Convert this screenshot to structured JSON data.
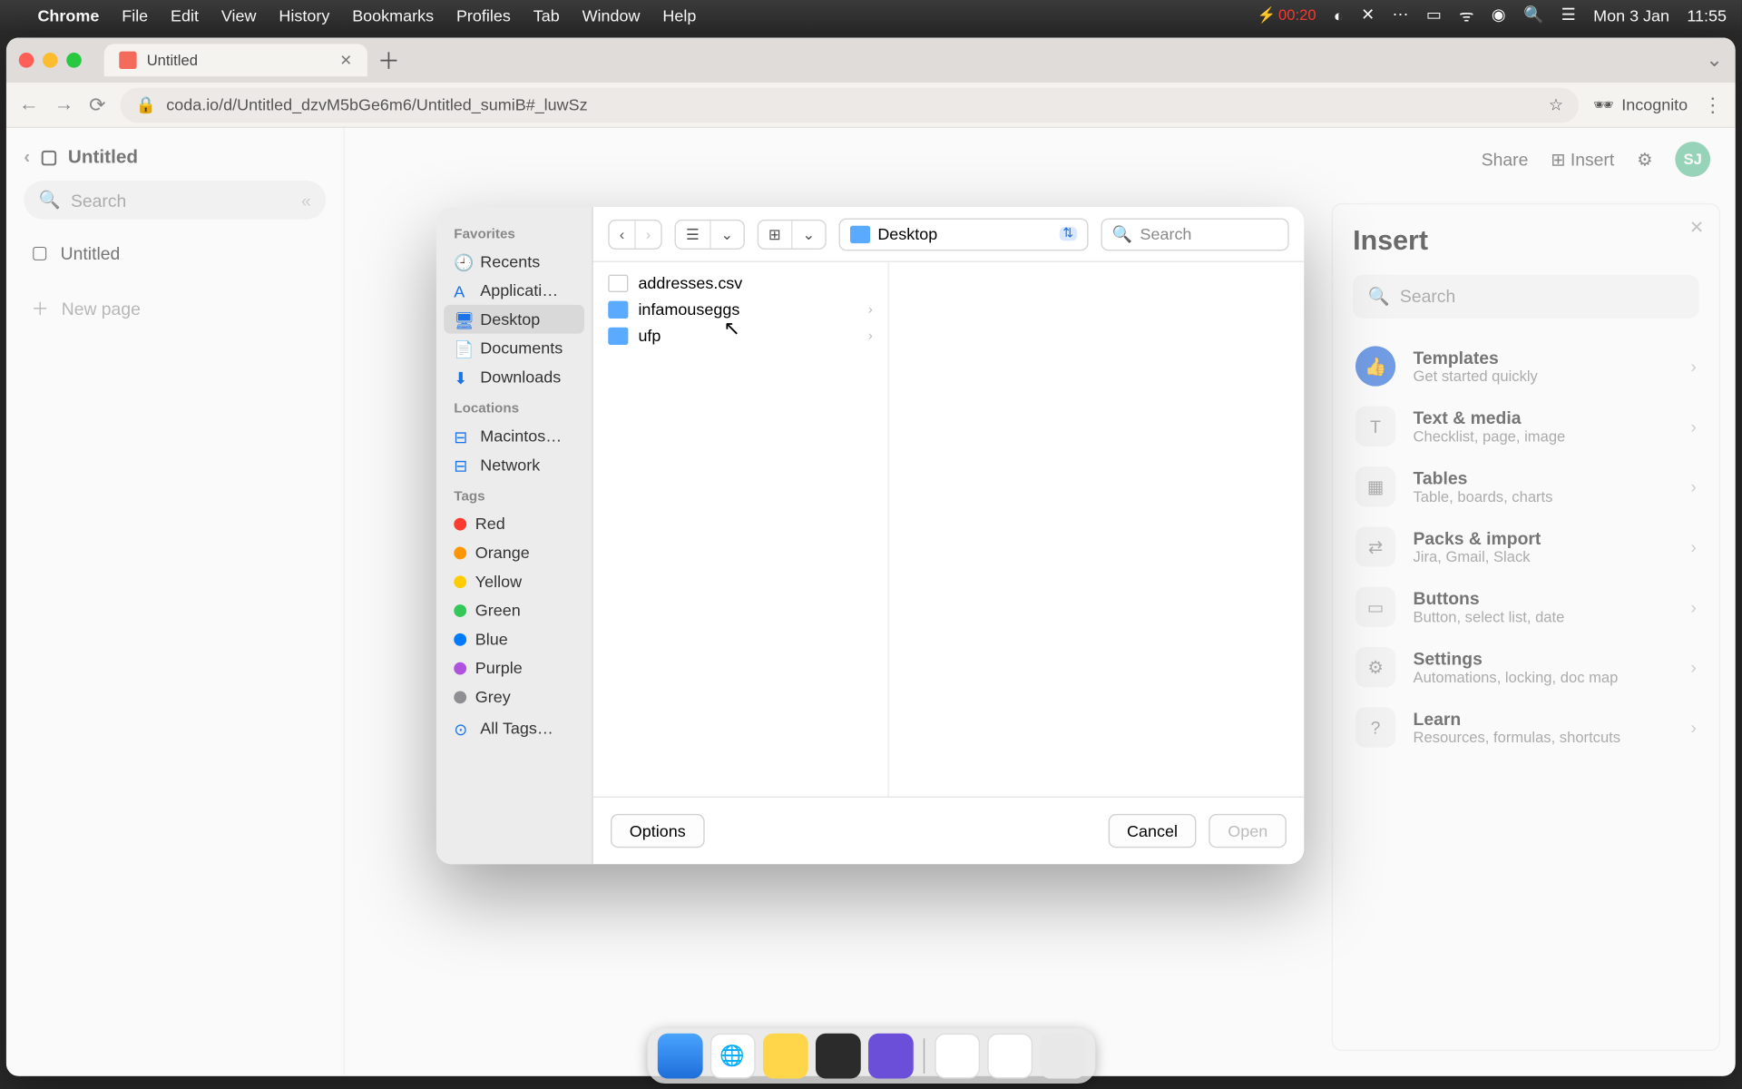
{
  "menubar": {
    "app": "Chrome",
    "items": [
      "File",
      "Edit",
      "View",
      "History",
      "Bookmarks",
      "Profiles",
      "Tab",
      "Window",
      "Help"
    ],
    "battery_time": "00:20",
    "date": "Mon 3 Jan",
    "time": "11:55"
  },
  "browser": {
    "tab_title": "Untitled",
    "url": "coda.io/d/Untitled_dzvM5bGe6m6/Untitled_sumiB#_luwSz",
    "incognito": "Incognito"
  },
  "coda": {
    "doc_title": "Untitled",
    "search_ph": "Search",
    "page": "Untitled",
    "new_page": "New page",
    "share": "Share",
    "insert": "Insert",
    "avatar": "SJ"
  },
  "insert_panel": {
    "title": "Insert",
    "search_ph": "Search",
    "items": [
      {
        "t": "Templates",
        "s": "Get started quickly"
      },
      {
        "t": "Text & media",
        "s": "Checklist, page, image"
      },
      {
        "t": "Tables",
        "s": "Table, boards, charts"
      },
      {
        "t": "Packs & import",
        "s": "Jira, Gmail, Slack"
      },
      {
        "t": "Buttons",
        "s": "Button, select list, date"
      },
      {
        "t": "Settings",
        "s": "Automations, locking, doc map"
      },
      {
        "t": "Learn",
        "s": "Resources, formulas, shortcuts"
      }
    ]
  },
  "dialog": {
    "favorites_hdr": "Favorites",
    "favorites": [
      "Recents",
      "Applicati…",
      "Desktop",
      "Documents",
      "Downloads"
    ],
    "selected_fav": "Desktop",
    "locations_hdr": "Locations",
    "locations": [
      "Macintos…",
      "Network"
    ],
    "tags_hdr": "Tags",
    "tags": [
      {
        "n": "Red",
        "c": "#ff3b30"
      },
      {
        "n": "Orange",
        "c": "#ff9500"
      },
      {
        "n": "Yellow",
        "c": "#ffcc00"
      },
      {
        "n": "Green",
        "c": "#34c759"
      },
      {
        "n": "Blue",
        "c": "#007aff"
      },
      {
        "n": "Purple",
        "c": "#af52de"
      },
      {
        "n": "Grey",
        "c": "#8e8e93"
      }
    ],
    "all_tags": "All Tags…",
    "location": "Desktop",
    "search_ph": "Search",
    "files": [
      {
        "n": "addresses.csv",
        "type": "file"
      },
      {
        "n": "infamouseggs",
        "type": "folder"
      },
      {
        "n": "ufp",
        "type": "folder"
      }
    ],
    "options": "Options",
    "cancel": "Cancel",
    "open": "Open"
  }
}
